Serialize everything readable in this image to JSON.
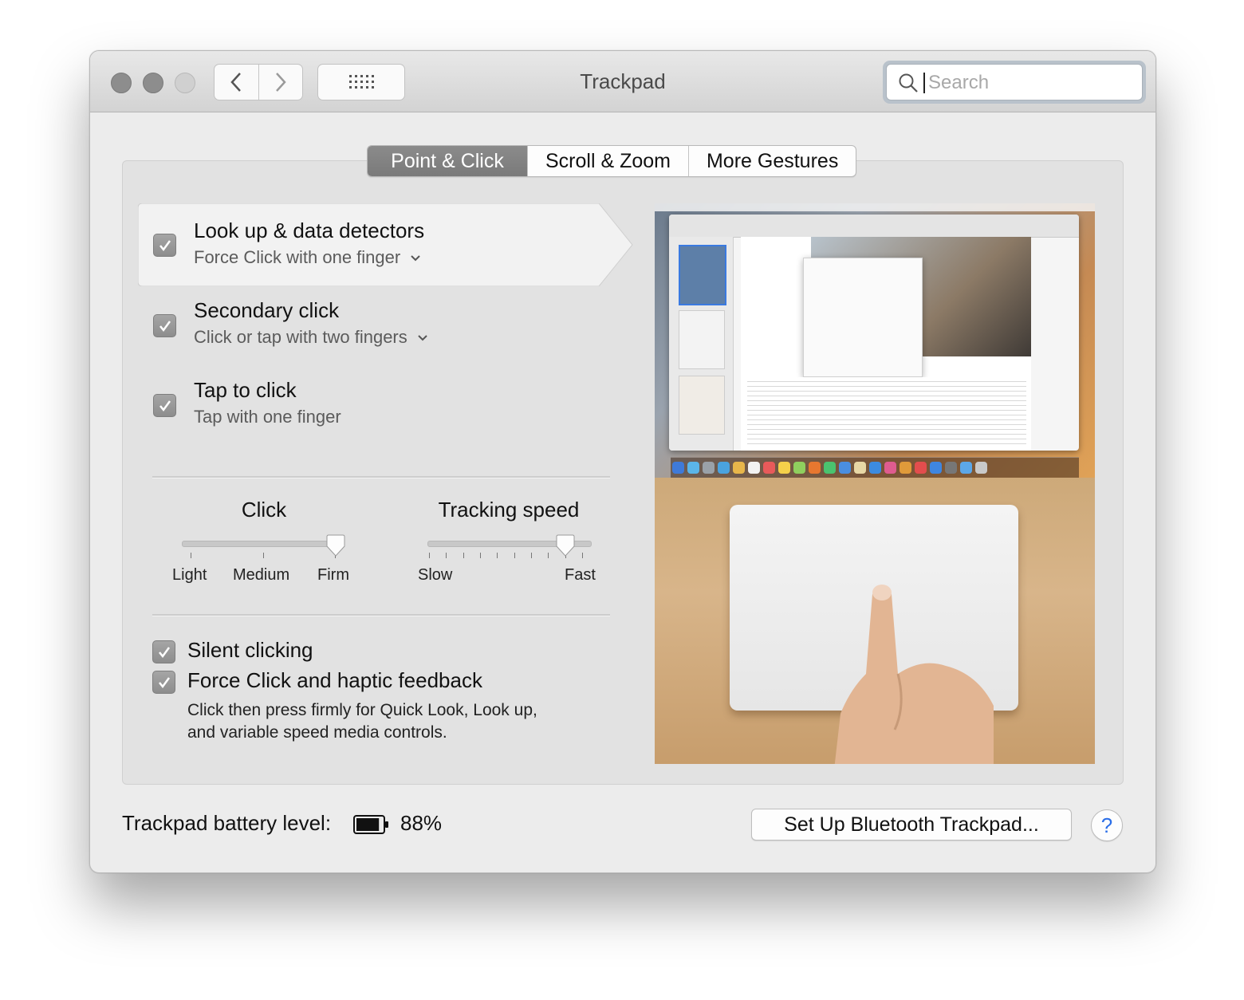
{
  "window": {
    "title": "Trackpad"
  },
  "search": {
    "placeholder": "Search"
  },
  "tabs": [
    {
      "label": "Point & Click",
      "active": true
    },
    {
      "label": "Scroll & Zoom",
      "active": false
    },
    {
      "label": "More Gestures",
      "active": false
    }
  ],
  "features": [
    {
      "title": "Look up & data detectors",
      "subtitle": "Force Click with one finger",
      "checked": true,
      "has_dropdown": true
    },
    {
      "title": "Secondary click",
      "subtitle": "Click or tap with two fingers",
      "checked": true,
      "has_dropdown": true
    },
    {
      "title": "Tap to click",
      "subtitle": "Tap with one finger",
      "checked": true,
      "has_dropdown": false
    }
  ],
  "click_slider": {
    "title": "Click",
    "labels": [
      "Light",
      "Medium",
      "Firm"
    ],
    "value": "Firm"
  },
  "tracking_slider": {
    "title": "Tracking speed",
    "min_label": "Slow",
    "max_label": "Fast",
    "steps": 10,
    "value_step": 8
  },
  "options": [
    {
      "title": "Silent clicking",
      "checked": true
    },
    {
      "title": "Force Click and haptic feedback",
      "checked": true
    }
  ],
  "force_click_description_line1": "Click then press firmly for Quick Look, Look up,",
  "force_click_description_line2": "and variable speed media controls.",
  "battery": {
    "label": "Trackpad battery level:",
    "percent_text": "88%",
    "level": 0.88
  },
  "buttons": {
    "setup": "Set Up Bluetooth Trackpad...",
    "help": "?"
  },
  "colors": {
    "accent_blue": "#2a6ee8",
    "checkbox_gray": "#9a9a9a",
    "tab_active": "#808080"
  }
}
